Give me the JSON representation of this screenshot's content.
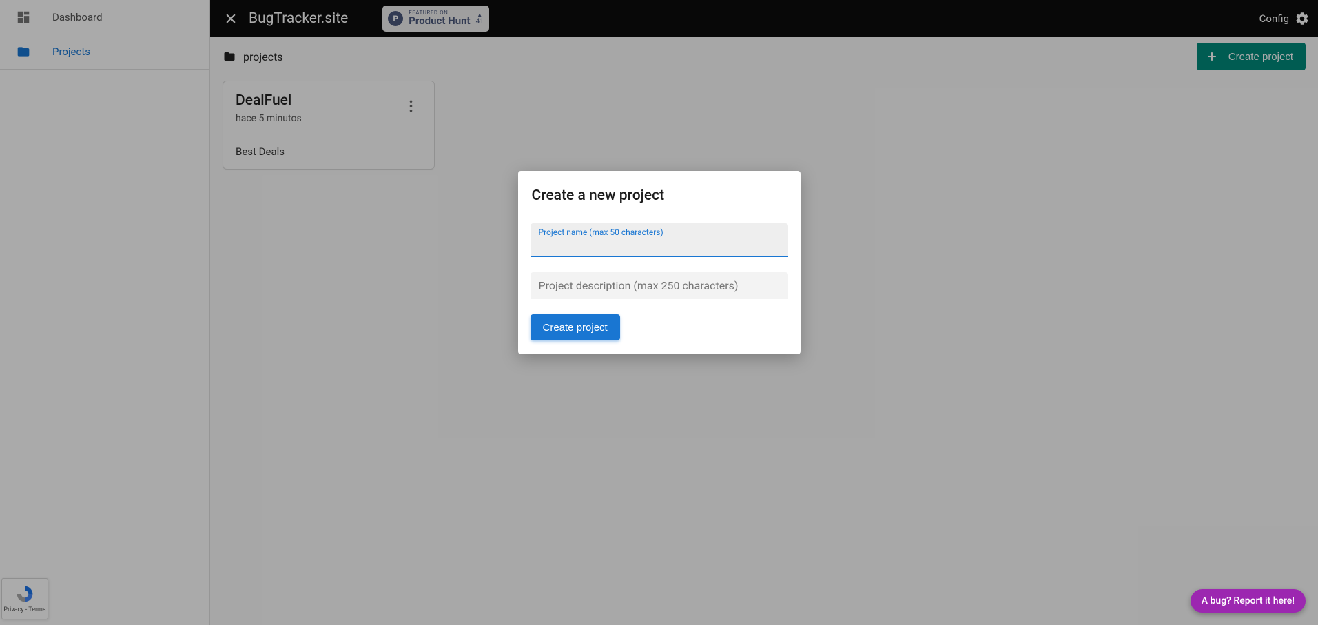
{
  "sidebar": {
    "items": [
      {
        "label": "Dashboard"
      },
      {
        "label": "Projects"
      }
    ]
  },
  "topbar": {
    "brand": "BugTracker.site",
    "product_hunt": {
      "featured": "FEATURED ON",
      "name": "Product Hunt",
      "count": "41"
    },
    "config": "Config"
  },
  "breadcrumb": {
    "label": "projects"
  },
  "actions": {
    "create_project": "Create project"
  },
  "projects": [
    {
      "name": "DealFuel",
      "time": "hace 5 minutos",
      "description": "Best Deals"
    }
  ],
  "dialog": {
    "title": "Create a new project",
    "name_label": "Project name (max 50 characters)",
    "name_value": "",
    "desc_placeholder": "Project description (max 250 characters)",
    "submit": "Create project"
  },
  "bug_pill": "A bug? Report it here!",
  "recaptcha": {
    "privacy": "Privacy",
    "sep": " - ",
    "terms": "Terms"
  }
}
